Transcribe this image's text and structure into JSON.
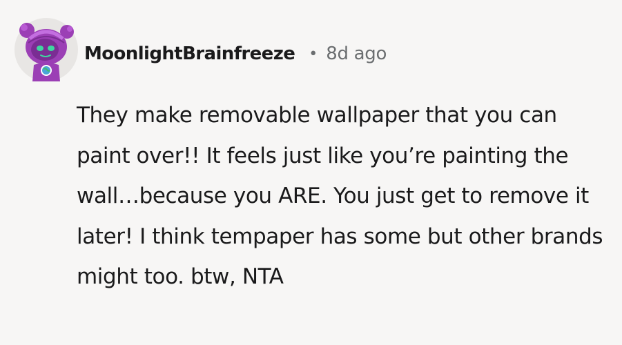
{
  "comment": {
    "author": "MoonlightBrainfreeze",
    "separator": "•",
    "timestamp": "8d ago",
    "body": "They make removable wallpaper that you can paint over!! It feels just like you’re painting the wall…because you ARE. You just get to remove it later! I think tempaper has some but other brands might too. btw, NTA",
    "avatar_icon": "purple-robot-avatar",
    "colors": {
      "background": "#f7f6f5",
      "text": "#1a1a1b",
      "muted": "#6b6e70",
      "avatar_purple": "#9b3fb5",
      "avatar_face": "#7a2d93",
      "avatar_eyes": "#3fd6a0"
    }
  }
}
